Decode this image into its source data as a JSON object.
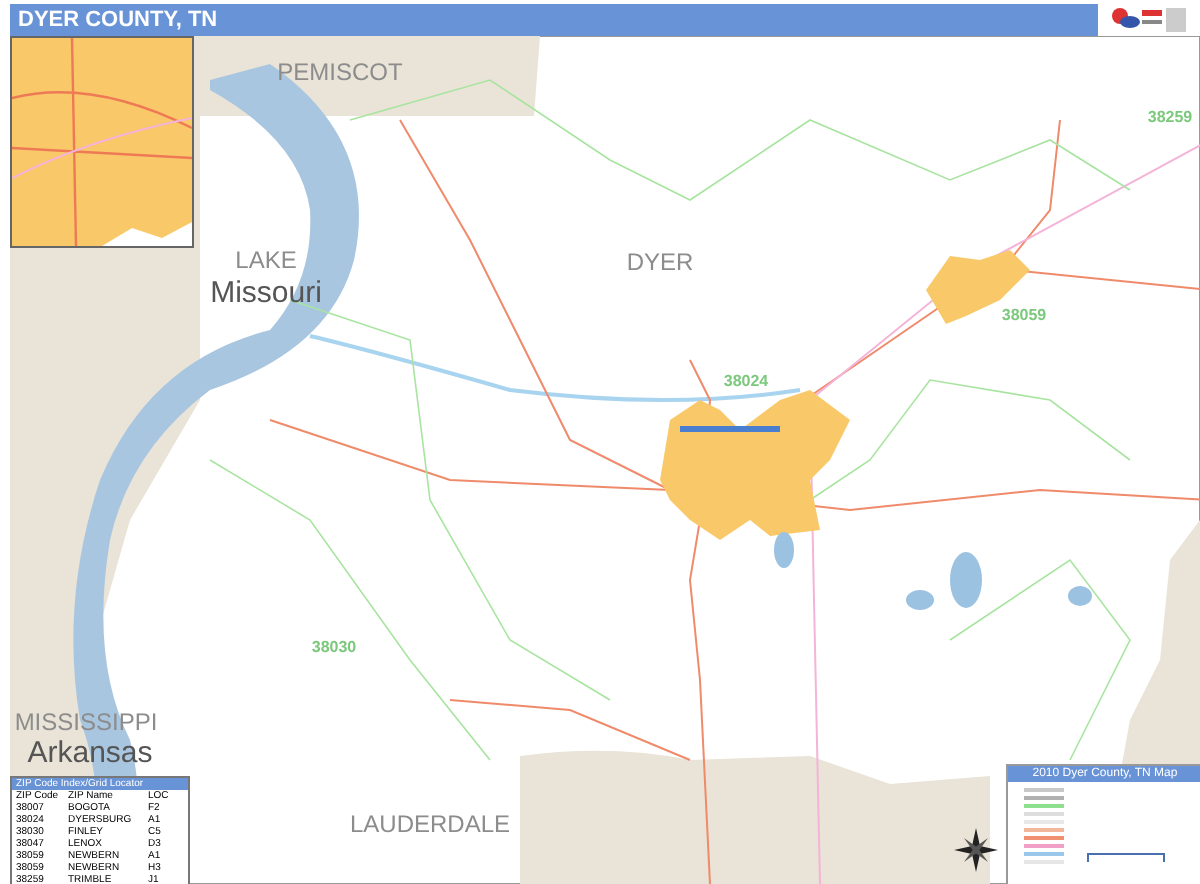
{
  "title": "DYER COUNTY, TN",
  "map_labels": [
    {
      "text": "PEMISCOT",
      "kind": "county"
    },
    {
      "text": "LAKE",
      "kind": "county"
    },
    {
      "text": "Missouri",
      "kind": "state"
    },
    {
      "text": "DYER",
      "kind": "county"
    },
    {
      "text": "38259",
      "kind": "zip"
    },
    {
      "text": "38059",
      "kind": "zip"
    },
    {
      "text": "38024",
      "kind": "zip"
    },
    {
      "text": "38030",
      "kind": "zip"
    },
    {
      "text": "MISSISSIPPI",
      "kind": "county"
    },
    {
      "text": "Arkansas",
      "kind": "state"
    },
    {
      "text": "LAUDERDALE",
      "kind": "county"
    }
  ],
  "zip_table": {
    "title": "ZIP Code Index/Grid Locator",
    "columns": [
      "ZIP Code",
      "ZIP Name",
      "LOC"
    ],
    "rows": [
      [
        "38007",
        "BOGOTA",
        "F2"
      ],
      [
        "38024",
        "DYERSBURG",
        "A1"
      ],
      [
        "38030",
        "FINLEY",
        "C5"
      ],
      [
        "38047",
        "LENOX",
        "D3"
      ],
      [
        "38059",
        "NEWBERN",
        "A1"
      ],
      [
        "38059",
        "NEWBERN",
        "H3"
      ],
      [
        "38259",
        "TRIMBLE",
        "J1"
      ]
    ]
  },
  "legend": {
    "title": "2010 Dyer County, TN Map"
  }
}
